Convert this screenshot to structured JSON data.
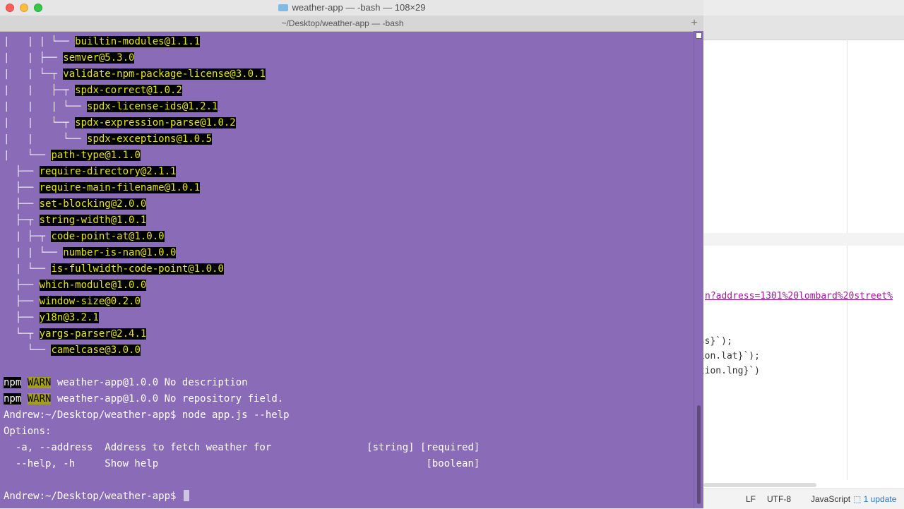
{
  "window": {
    "title": "weather-app — -bash — 108×29",
    "tab_title": "~/Desktop/weather-app — -bash",
    "new_tab_symbol": "+"
  },
  "tree_lines": [
    {
      "prefix": "|   | | └── ",
      "pkg": "builtin-modules@1.1.1"
    },
    {
      "prefix": "|   | ├── ",
      "pkg": "semver@5.3.0"
    },
    {
      "prefix": "|   | └─┬ ",
      "pkg": "validate-npm-package-license@3.0.1"
    },
    {
      "prefix": "|   |   ├─┬ ",
      "pkg": "spdx-correct@1.0.2"
    },
    {
      "prefix": "|   |   | └── ",
      "pkg": "spdx-license-ids@1.2.1"
    },
    {
      "prefix": "|   |   └─┬ ",
      "pkg": "spdx-expression-parse@1.0.2"
    },
    {
      "prefix": "|   |     └── ",
      "pkg": "spdx-exceptions@1.0.5"
    },
    {
      "prefix": "|   └── ",
      "pkg": "path-type@1.1.0"
    },
    {
      "prefix": "  ├── ",
      "pkg": "require-directory@2.1.1"
    },
    {
      "prefix": "  ├── ",
      "pkg": "require-main-filename@1.0.1"
    },
    {
      "prefix": "  ├── ",
      "pkg": "set-blocking@2.0.0"
    },
    {
      "prefix": "  ├─┬ ",
      "pkg": "string-width@1.0.1"
    },
    {
      "prefix": "  | ├─┬ ",
      "pkg": "code-point-at@1.0.0"
    },
    {
      "prefix": "  | | └── ",
      "pkg": "number-is-nan@1.0.0"
    },
    {
      "prefix": "  | └── ",
      "pkg": "is-fullwidth-code-point@1.0.0"
    },
    {
      "prefix": "  ├── ",
      "pkg": "which-module@1.0.0"
    },
    {
      "prefix": "  ├── ",
      "pkg": "window-size@0.2.0"
    },
    {
      "prefix": "  ├── ",
      "pkg": "y18n@3.2.1"
    },
    {
      "prefix": "  └─┬ ",
      "pkg": "yargs-parser@2.4.1"
    },
    {
      "prefix": "    └── ",
      "pkg": "camelcase@3.0.0"
    }
  ],
  "warnings": [
    {
      "npm": "npm",
      "level": "WARN",
      "text": " weather-app@1.0.0 No description"
    },
    {
      "npm": "npm",
      "level": "WARN",
      "text": " weather-app@1.0.0 No repository field."
    }
  ],
  "command_line": "Andrew:~/Desktop/weather-app$ node app.js --help",
  "help_lines": [
    "Options:",
    "  -a, --address  Address to fetch weather for                [string] [required]",
    "  --help, -h     Show help                                             [boolean]"
  ],
  "prompt": "Andrew:~/Desktop/weather-app$ ",
  "editor": {
    "url_line": "n?address=1301%20lombard%20street%",
    "code_lines": [
      "ess}`);",
      "tion.lat}`);",
      "ation.lng}`)"
    ],
    "status": {
      "eol": "LF",
      "encoding": "UTF-8",
      "language": "JavaScript",
      "updates": "1 update"
    }
  }
}
